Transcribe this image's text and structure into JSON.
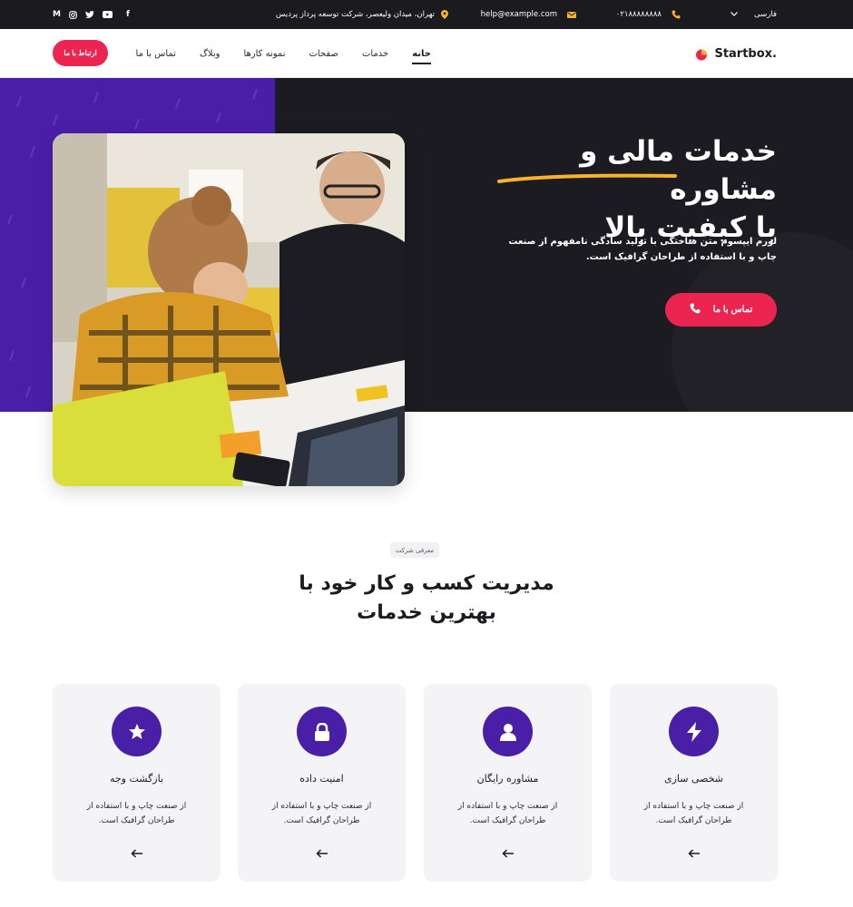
{
  "topbar": {
    "social": [
      "M",
      "instagram",
      "twitter",
      "youtube",
      "f"
    ],
    "address": "تهران، میدان ولیعصر، شرکت توسعه پرداز پردیس",
    "email": "help@example.com",
    "phone": "۰۲۱۸۸۸۸۸۸۸۸",
    "language": "فارسی"
  },
  "header": {
    "cta": "ارتباط با ما",
    "nav": [
      "خانه",
      "خدمات",
      "صفحات",
      "نمونه کارها",
      "وبلاگ",
      "تماس با ما"
    ],
    "brand": "Startbox."
  },
  "hero": {
    "title_line1": "خدمات مالی و مشاوره",
    "title_line2": "با کیفیت بالا",
    "description": "لورم ایپسوم متن ساختگی با تولید سادگی نامفهوم از صنعت چاپ و با استفاده از طراحان گرافیک است.",
    "button": "تماس با ما"
  },
  "intro": {
    "tag": "معرفی شرکت",
    "title_line1": "مدیریت کسب و کار خود با",
    "title_line2": "بهترین خدمات"
  },
  "cards": [
    {
      "icon": "bolt-icon",
      "title": "شخصی سازی",
      "text": "از صنعت چاپ و با استفاده از طراحان گرافیک است."
    },
    {
      "icon": "user-icon",
      "title": "مشاوره رایگان",
      "text": "از صنعت چاپ و با استفاده از طراحان گرافیک است."
    },
    {
      "icon": "lock-icon",
      "title": "امنیت داده",
      "text": "از صنعت چاپ و با استفاده از طراحان گرافیک است."
    },
    {
      "icon": "star-icon",
      "title": "بازگشت وجه",
      "text": "از صنعت چاپ و با استفاده از طراحان گرافیک است."
    }
  ],
  "colors": {
    "accent": "#ec2550",
    "purple": "#4a1fa8",
    "dark": "#1c1b21",
    "yellow": "#f7b32b"
  }
}
